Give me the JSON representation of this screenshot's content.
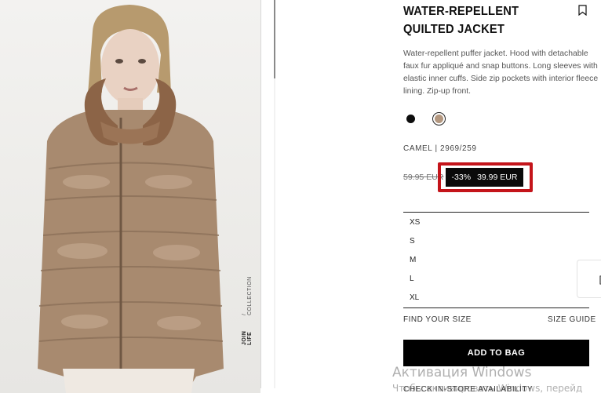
{
  "product": {
    "title": "WATER-REPELLENT QUILTED JACKET",
    "description": "Water-repellent puffer jacket. Hood with detachable faux fur appliqué and snap buttons. Long sleeves with elastic inner cuffs. Side zip pockets with interior fleece lining. Zip-up front.",
    "color_code": "CAMEL | 2969/259",
    "colors": [
      {
        "name": "black",
        "hex": "#0d0d0d"
      },
      {
        "name": "camel",
        "hex": "#b3977f",
        "selected": true
      }
    ]
  },
  "image": {
    "tag_bold": "JOIN LIFE",
    "tag_light": "/ COLLECTION"
  },
  "price": {
    "old": "59.95 EUR",
    "discount": "-33%",
    "current": "39.99 EUR",
    "highlight_color": "#c4141a"
  },
  "sizes": [
    "XS",
    "S",
    "M",
    "L",
    "XL"
  ],
  "links": {
    "find_size": "FIND YOUR SIZE",
    "size_guide": "SIZE GUIDE",
    "store_availability": "CHECK IN-STORE AVAILABILITY"
  },
  "actions": {
    "add_to_bag": "ADD TO BAG"
  },
  "side_widget": {
    "glyph": "["
  },
  "watermark": {
    "title": "Активация Windows",
    "subtitle": "Чтобы активировать Windows, перейд"
  }
}
